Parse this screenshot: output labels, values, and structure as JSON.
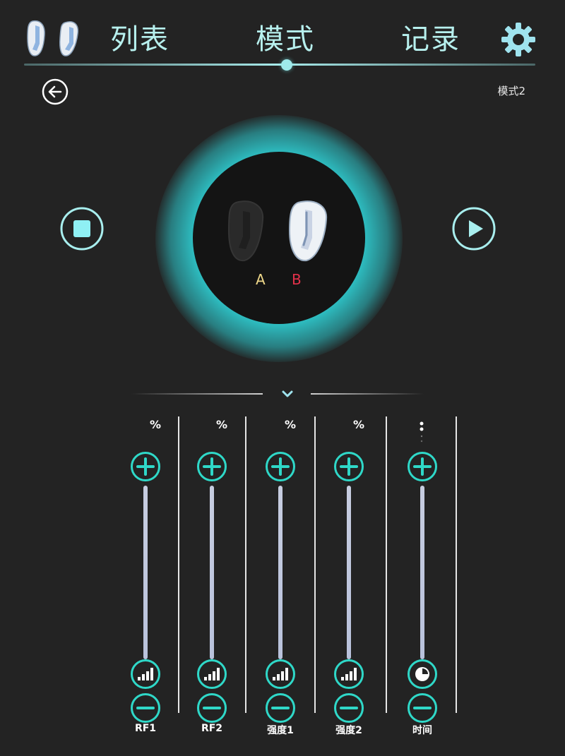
{
  "header": {
    "tabs": [
      {
        "label": "列表"
      },
      {
        "label": "模式"
      },
      {
        "label": "记录"
      }
    ],
    "active_tab": "模式"
  },
  "mode": {
    "label": "模式2"
  },
  "channels": {
    "a": "A",
    "b": "B"
  },
  "colors": {
    "accent": "#3ee3e6",
    "button_ring": "#2fd8c8",
    "label_tint": "#b7f0ee",
    "channel_a": "#f0d98a",
    "channel_b": "#e3314a",
    "background": "#232323"
  },
  "controls": [
    {
      "label": "RF1",
      "unit": "%",
      "level_icon": "signal-bars-icon"
    },
    {
      "label": "RF2",
      "unit": "%",
      "level_icon": "signal-bars-icon"
    },
    {
      "label": "强度1",
      "unit": "%",
      "level_icon": "signal-bars-icon"
    },
    {
      "label": "强度2",
      "unit": "%",
      "level_icon": "signal-bars-icon"
    },
    {
      "label": "时间",
      "unit": "",
      "level_icon": "timer-icon"
    }
  ],
  "icons": {
    "logo": "device-pair-icon",
    "settings": "gear-icon",
    "back": "arrow-left-icon",
    "stop": "stop-icon",
    "play": "play-icon",
    "collapse": "chevron-down-icon"
  }
}
